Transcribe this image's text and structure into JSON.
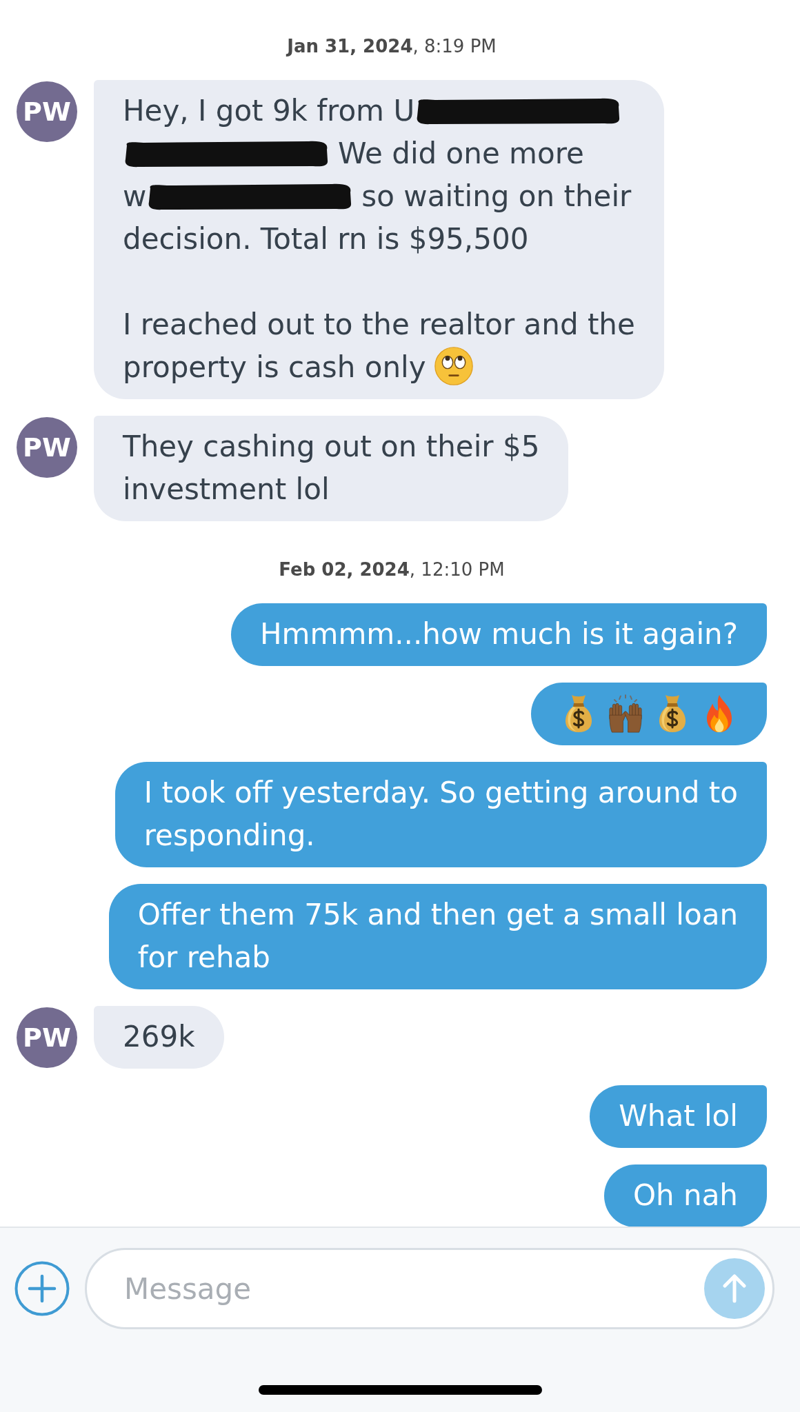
{
  "thread": [
    {
      "kind": "date",
      "text": "**Jan 31, 2024**, 8:19 PM"
    },
    {
      "kind": "incoming",
      "avatar": "PW",
      "paragraphs": [
        {
          "lines": [
            [
              {
                "kind": "text",
                "text": "Hey, I got 9k from U"
              },
              {
                "kind": "redaction"
              }
            ],
            [
              {
                "kind": "redaction"
              },
              {
                "kind": "text",
                "text": "We did one more"
              }
            ],
            [
              {
                "kind": "text",
                "text": "w"
              },
              {
                "kind": "redaction"
              },
              {
                "kind": "text",
                "text": "so waiting on their"
              }
            ],
            [
              {
                "kind": "text",
                "text": "decision. Total rn is $95,500"
              }
            ]
          ]
        },
        {
          "lines": [
            [
              {
                "kind": "text",
                "text": "I reached out to the realtor and the"
              }
            ],
            [
              {
                "kind": "text",
                "text": "property is cash only"
              },
              {
                "kind": "eyeroll"
              }
            ]
          ]
        }
      ]
    },
    {
      "kind": "incoming",
      "avatar": "PW",
      "lines": [
        "They cashing out on their $5",
        "investment lol"
      ]
    },
    {
      "kind": "date",
      "text": "**Feb 02, 2024**, 12:10 PM"
    },
    {
      "kind": "outgoing",
      "lines": [
        "Hmmmm...how much is it again?"
      ]
    },
    {
      "kind": "outgoing",
      "emojis": [
        {
          "kind": "moneybag"
        },
        {
          "kind": "raisedhands"
        },
        {
          "kind": "moneybag"
        },
        {
          "kind": "fire"
        }
      ]
    },
    {
      "kind": "outgoing",
      "lines": [
        "I took off yesterday. So getting around to",
        "responding."
      ]
    },
    {
      "kind": "outgoing",
      "lines": [
        "Offer them 75k and then get a small loan",
        "for rehab"
      ]
    },
    {
      "kind": "incoming",
      "avatar": "PW",
      "lines": [
        "269k"
      ]
    },
    {
      "kind": "outgoing",
      "lines": [
        "What lol"
      ]
    },
    {
      "kind": "outgoing",
      "lines": [
        "Oh nah"
      ]
    }
  ],
  "composer": {
    "placeholder": "Message"
  }
}
